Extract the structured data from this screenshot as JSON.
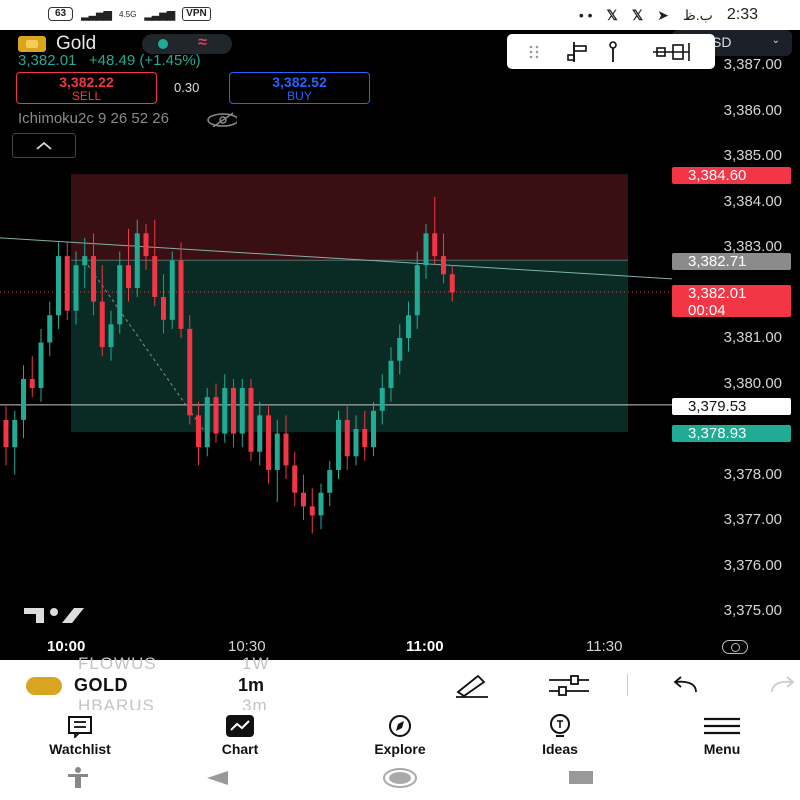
{
  "status_bar": {
    "battery": "63",
    "network": "4.5G",
    "vpn": "VPN",
    "notif_dots": "• •",
    "date_chars": "ب.ظ",
    "time": "2:33"
  },
  "header": {
    "symbol": "Gold",
    "last_price": "3,382.01",
    "change": "+48.49 (+1.45%)",
    "sell_price": "3,382.22",
    "sell_label": "SELL",
    "spread": "0.30",
    "buy_price": "3,382.52",
    "buy_label": "BUY",
    "indicator_name": "Ichimoku2c",
    "indicator_params": "9 26 52 26",
    "currency": "USD",
    "currency_visible": "SD"
  },
  "price_axis": {
    "ticks": [
      "3,387.00",
      "3,386.00",
      "3,385.00",
      "3,384.00",
      "3,383.00",
      "3,382.00",
      "3,381.00",
      "3,380.00",
      "3,379.00",
      "3,378.00",
      "3,377.00",
      "3,376.00",
      "3,375.00"
    ],
    "badges": {
      "upper": "3,384.60",
      "gray": "3,382.71",
      "current": "3,382.01",
      "countdown": "00:04",
      "white": "3,379.53",
      "lower": "3,378.93"
    }
  },
  "time_axis": [
    "10:00",
    "10:30",
    "11:00",
    "11:30"
  ],
  "colors": {
    "up": "#22ab94",
    "down": "#f23645",
    "loss_zone": "#3a0f14",
    "profit_zone": "#0a2a24"
  },
  "chart_data": {
    "type": "candlestick",
    "symbol": "Gold",
    "interval": "1m",
    "ylim": [
      3374.7,
      3387.1
    ],
    "position": {
      "direction": "short",
      "entry": 3382.71,
      "stop": 3384.6,
      "target": 3378.93
    },
    "candles_ohlc": [
      [
        3379.2,
        3379.5,
        3378.2,
        3378.6
      ],
      [
        3378.6,
        3379.4,
        3378.0,
        3379.2
      ],
      [
        3379.2,
        3380.4,
        3378.8,
        3380.1
      ],
      [
        3380.1,
        3380.6,
        3379.7,
        3379.9
      ],
      [
        3379.9,
        3381.2,
        3379.6,
        3380.9
      ],
      [
        3380.9,
        3381.8,
        3380.6,
        3381.5
      ],
      [
        3381.5,
        3383.1,
        3381.2,
        3382.8
      ],
      [
        3382.8,
        3383.1,
        3381.4,
        3381.6
      ],
      [
        3381.6,
        3382.9,
        3381.3,
        3382.6
      ],
      [
        3382.6,
        3383.2,
        3382.1,
        3382.8
      ],
      [
        3382.8,
        3383.3,
        3381.5,
        3381.8
      ],
      [
        3381.8,
        3382.6,
        3380.6,
        3380.8
      ],
      [
        3380.8,
        3381.6,
        3380.5,
        3381.3
      ],
      [
        3381.3,
        3382.9,
        3381.1,
        3382.6
      ],
      [
        3382.6,
        3383.4,
        3381.8,
        3382.1
      ],
      [
        3382.1,
        3383.6,
        3381.9,
        3383.3
      ],
      [
        3383.3,
        3383.5,
        3382.5,
        3382.8
      ],
      [
        3382.8,
        3383.6,
        3381.7,
        3381.9
      ],
      [
        3381.9,
        3382.4,
        3381.1,
        3381.4
      ],
      [
        3381.4,
        3382.9,
        3381.2,
        3382.7
      ],
      [
        3382.7,
        3383.1,
        3381.0,
        3381.2
      ],
      [
        3381.2,
        3381.5,
        3379.1,
        3379.3
      ],
      [
        3379.3,
        3379.6,
        3378.2,
        3378.6
      ],
      [
        3378.6,
        3379.9,
        3378.4,
        3379.7
      ],
      [
        3379.7,
        3380.0,
        3378.7,
        3378.9
      ],
      [
        3378.9,
        3380.2,
        3378.7,
        3379.9
      ],
      [
        3379.9,
        3380.1,
        3378.6,
        3378.9
      ],
      [
        3378.9,
        3380.1,
        3378.6,
        3379.9
      ],
      [
        3379.9,
        3380.1,
        3378.3,
        3378.5
      ],
      [
        3378.5,
        3379.6,
        3378.2,
        3379.3
      ],
      [
        3379.3,
        3379.5,
        3377.8,
        3378.1
      ],
      [
        3378.1,
        3379.2,
        3377.4,
        3378.9
      ],
      [
        3378.9,
        3379.3,
        3377.9,
        3378.2
      ],
      [
        3378.2,
        3378.5,
        3377.3,
        3377.6
      ],
      [
        3377.6,
        3378.0,
        3377.0,
        3377.3
      ],
      [
        3377.3,
        3377.7,
        3376.7,
        3377.1
      ],
      [
        3377.1,
        3377.8,
        3376.8,
        3377.6
      ],
      [
        3377.6,
        3378.3,
        3377.3,
        3378.1
      ],
      [
        3378.1,
        3379.4,
        3377.9,
        3379.2
      ],
      [
        3379.2,
        3379.5,
        3378.1,
        3378.4
      ],
      [
        3378.4,
        3379.3,
        3378.2,
        3379.0
      ],
      [
        3379.0,
        3379.4,
        3378.3,
        3378.6
      ],
      [
        3378.6,
        3379.6,
        3378.4,
        3379.4
      ],
      [
        3379.4,
        3380.2,
        3379.1,
        3379.9
      ],
      [
        3379.9,
        3380.8,
        3379.6,
        3380.5
      ],
      [
        3380.5,
        3381.3,
        3380.2,
        3381.0
      ],
      [
        3381.0,
        3381.8,
        3380.7,
        3381.5
      ],
      [
        3381.5,
        3382.9,
        3381.2,
        3382.6
      ],
      [
        3382.6,
        3383.5,
        3382.3,
        3383.3
      ],
      [
        3383.3,
        3384.1,
        3382.6,
        3382.8
      ],
      [
        3382.8,
        3383.3,
        3382.2,
        3382.4
      ],
      [
        3382.4,
        3382.6,
        3381.8,
        3382.0
      ]
    ]
  },
  "toolbar": {
    "ghost_top": "FLOWUS",
    "ghost_top_interval": "1W",
    "symbol": "GOLD",
    "interval": "1m",
    "ghost_bottom": "HBARUS",
    "ghost_bottom_interval": "3m"
  },
  "nav": {
    "watchlist": "Watchlist",
    "chart": "Chart",
    "explore": "Explore",
    "ideas": "Ideas",
    "menu": "Menu"
  }
}
